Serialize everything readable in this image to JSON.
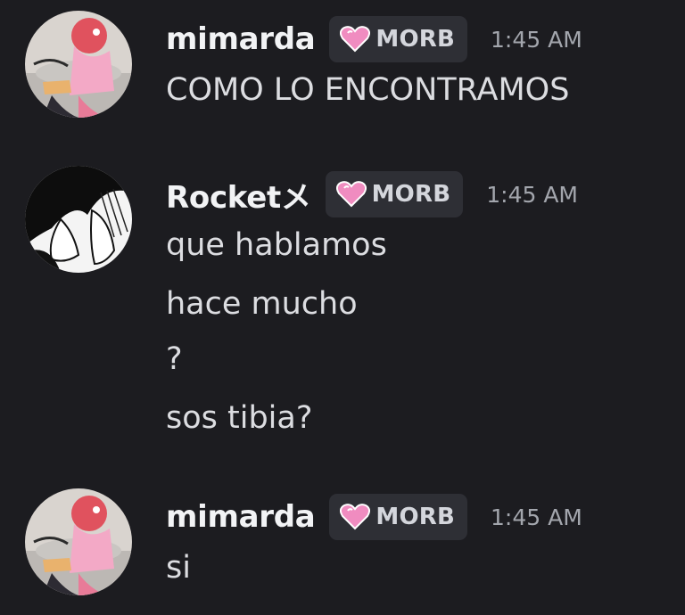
{
  "messages": [
    {
      "username": "mimarda",
      "tag": "MORB",
      "time": "1:45 AM",
      "lines": [
        "COMO LO ENCONTRAMOS"
      ]
    },
    {
      "username": "Rocketメ",
      "tag": "MORB",
      "time": "1:45 AM",
      "lines": [
        "que hablamos",
        "hace mucho",
        "?",
        "sos tibia?"
      ]
    },
    {
      "username": "mimarda",
      "tag": "MORB",
      "time": "1:45 AM",
      "lines": [
        "si"
      ]
    }
  ],
  "colors": {
    "background": "#1c1c20",
    "tag_background": "#2e2f35",
    "heart": "#f08cc0",
    "username": "#f2f3f5",
    "text": "#dcdde1",
    "timestamp": "#a3a6ad"
  },
  "icons": {
    "tag_icon": "pink-heart-icon"
  }
}
